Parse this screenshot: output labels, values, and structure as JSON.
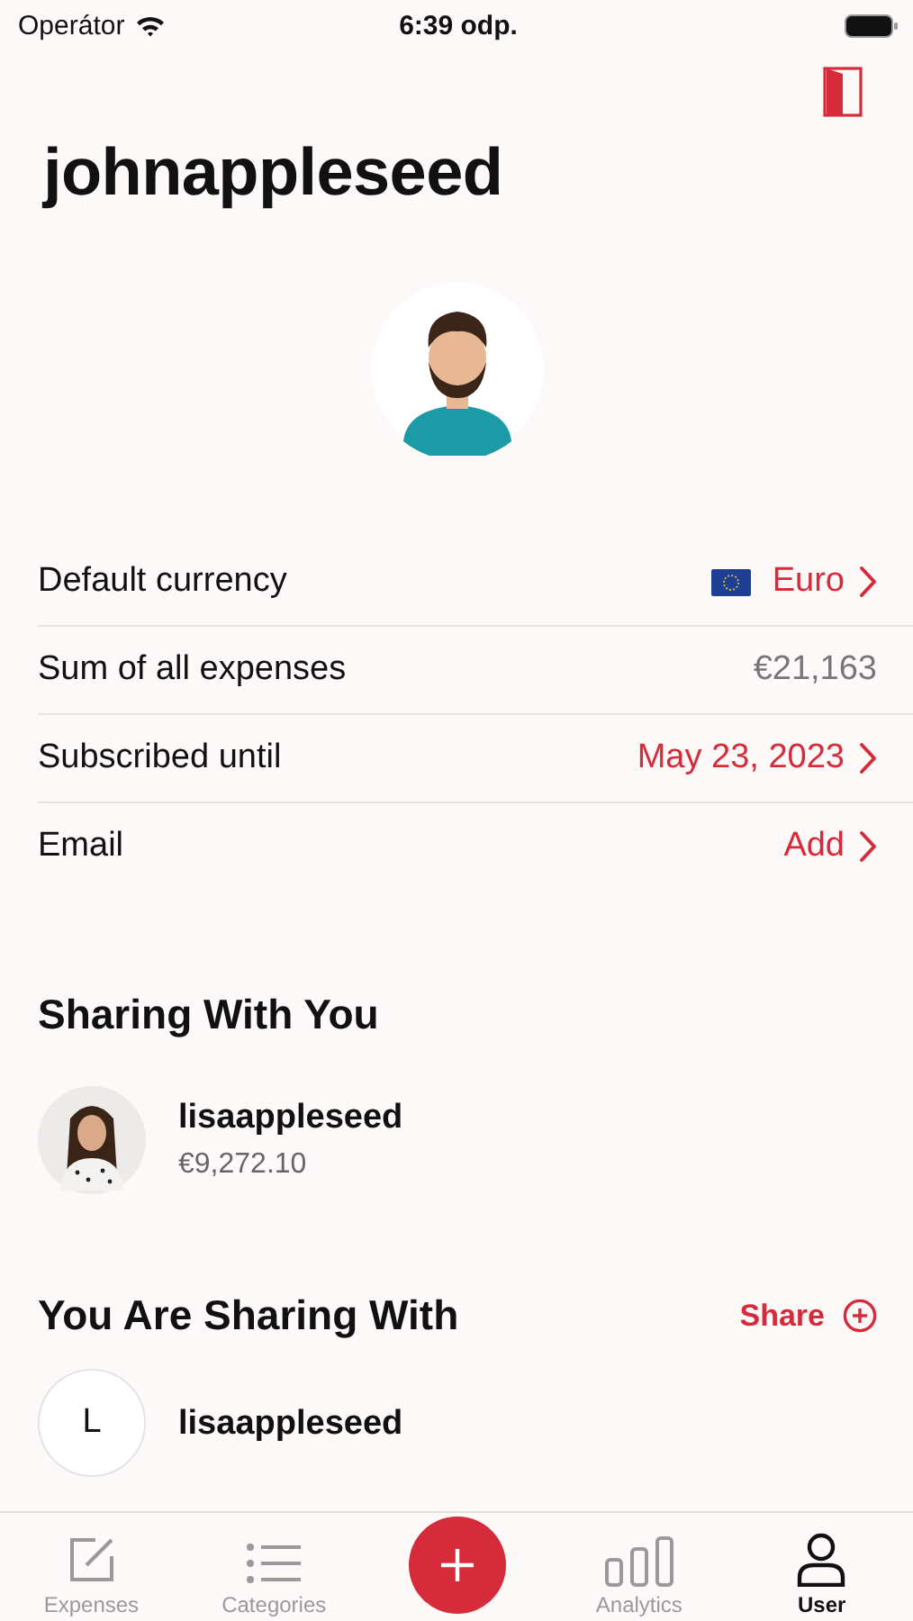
{
  "status_bar": {
    "carrier": "Operátor",
    "time": "6:39 odp."
  },
  "profile": {
    "username": "johnappleseed"
  },
  "settings": [
    {
      "label": "Default currency",
      "value": "Euro",
      "kind": "currency"
    },
    {
      "label": "Sum of all expenses",
      "value": "€21,163",
      "kind": "plain"
    },
    {
      "label": "Subscribed until",
      "value": "May 23, 2023",
      "kind": "link"
    },
    {
      "label": "Email",
      "value": "Add",
      "kind": "link"
    }
  ],
  "sharing_with_you": {
    "title": "Sharing With You",
    "people": [
      {
        "name": "lisaappleseed",
        "amount": "€9,272.10",
        "kind": "picture"
      }
    ]
  },
  "you_are_sharing_with": {
    "title": "You Are Sharing With",
    "action": "Share",
    "people": [
      {
        "name": "lisaappleseed",
        "kind": "initial",
        "initial": "L"
      }
    ]
  },
  "tab_bar": [
    {
      "kind": "tab",
      "label": "Expenses",
      "selected": false
    },
    {
      "kind": "tab",
      "label": "Categories",
      "selected": false
    },
    {
      "kind": "add"
    },
    {
      "kind": "tab",
      "label": "Analytics",
      "selected": false
    },
    {
      "kind": "tab",
      "label": "User",
      "selected": true
    }
  ]
}
